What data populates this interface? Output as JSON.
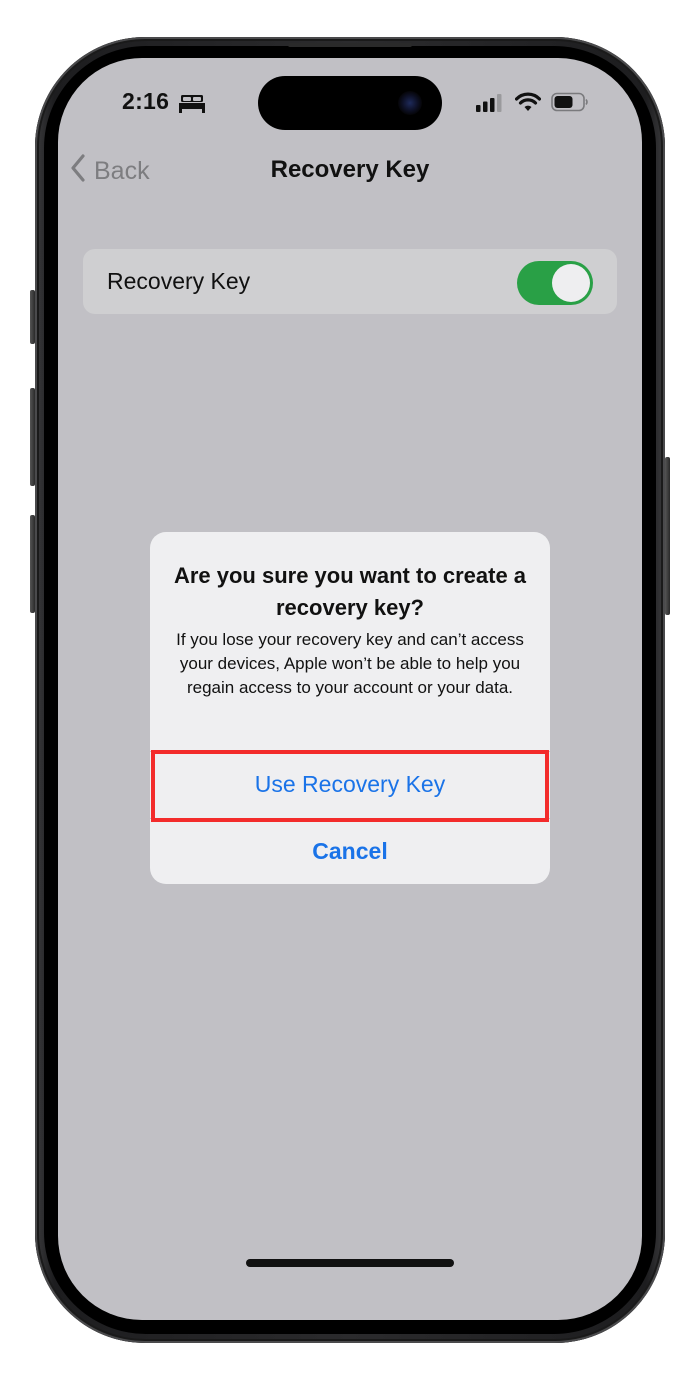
{
  "status_bar": {
    "time": "2:16",
    "focus_icon": "bed-icon",
    "signal_icon": "cellular-signal-icon",
    "wifi_icon": "wifi-icon",
    "battery_icon": "battery-icon"
  },
  "nav": {
    "back_label": "Back",
    "title": "Recovery Key"
  },
  "settings": {
    "rows": [
      {
        "label": "Recovery Key",
        "toggle_on": true
      }
    ]
  },
  "alert": {
    "title": "Are you sure you want to create a recovery key?",
    "message": "If you lose your recovery key and can’t access your devices, Apple won’t be able to help you regain access to your account or your data.",
    "buttons": [
      {
        "label": "Use Recovery Key",
        "highlighted": true
      },
      {
        "label": "Cancel",
        "style": "bold"
      }
    ]
  },
  "colors": {
    "accent_blue": "#1a73e8",
    "toggle_green": "#29a046",
    "highlight_red": "#f32b2b",
    "dimmed_background": "#c1c0c5"
  }
}
